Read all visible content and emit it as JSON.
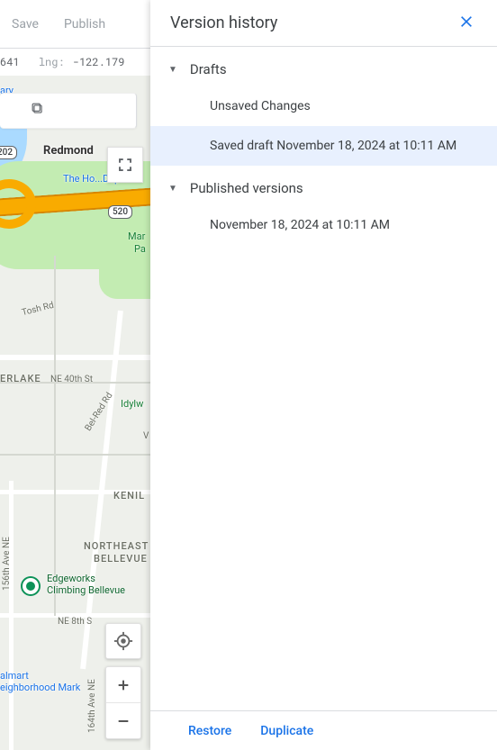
{
  "toolbar": {
    "save_label": "Save",
    "publish_label": "Publish"
  },
  "coords": {
    "lat_fragment": "641",
    "lng_label": "lng:",
    "lng_value": "-122.179"
  },
  "map": {
    "city_redmond": "Redmond",
    "poi_home_depot": "The Ho...Dep...",
    "park_mar": "Mar",
    "park_pa": "Pa",
    "street_tosh": "Tosh Rd",
    "street_40th": "NE 40th St",
    "area_erlake": "ERLAKE",
    "park_idylw": "Idylw",
    "street_belred": "Bel-Red Rd",
    "area_kenil": "KENIL",
    "letter_v": "V",
    "area_nebellevue1": "NORTHEAST",
    "area_nebellevue2": "BELLEVUE",
    "poi_edgeworks1": "Edgeworks",
    "poi_edgeworks2": "Climbing Bellevue",
    "street_8th": "NE 8th S",
    "poi_walmart1": "almart",
    "poi_walmart2": "eighborhood Mark",
    "street_156th": "156th Ave NE",
    "street_164th": "164th Ave NE",
    "shield_520": "520",
    "shield_202": "202",
    "library": "ary"
  },
  "panel": {
    "title": "Version history",
    "sections": {
      "drafts": {
        "label": "Drafts",
        "items": [
          {
            "label": "Unsaved Changes",
            "selected": false
          },
          {
            "label": "Saved draft November 18, 2024 at 10:11 AM",
            "selected": true
          }
        ]
      },
      "published": {
        "label": "Published versions",
        "items": [
          {
            "label": "November 18, 2024 at 10:11 AM",
            "selected": false
          }
        ]
      }
    },
    "footer": {
      "restore_label": "Restore",
      "duplicate_label": "Duplicate"
    }
  }
}
